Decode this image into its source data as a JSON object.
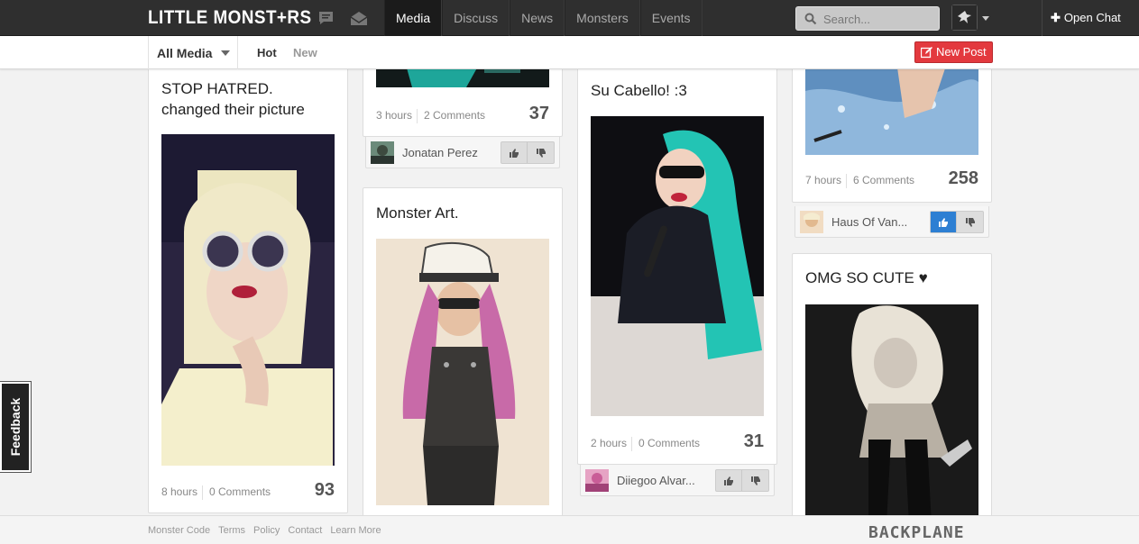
{
  "app": {
    "logo": "LITTLE MONST+RS"
  },
  "topbar": {
    "icons": [
      "chat-bubble-icon",
      "mail-icon"
    ],
    "nav": [
      {
        "label": "Media",
        "active": true
      },
      {
        "label": "Discuss",
        "active": false
      },
      {
        "label": "News",
        "active": false
      },
      {
        "label": "Monsters",
        "active": false
      },
      {
        "label": "Events",
        "active": false
      }
    ],
    "search": {
      "placeholder": "Search...",
      "value": ""
    },
    "open_chat": "Open Chat"
  },
  "subbar": {
    "filter": "All Media",
    "tabs": [
      {
        "label": "Hot",
        "active": true
      },
      {
        "label": "New",
        "active": false
      }
    ],
    "new_post": "New Post"
  },
  "colors": {
    "accent_red": "#e3393e",
    "vote_active": "#2d7fd3",
    "topbar": "#2f2f2f"
  },
  "posts": [
    {
      "title": "STOP HATRED. changed their picture",
      "time": "8 hours",
      "comments": "0 Comments",
      "score": "93"
    },
    {
      "title": "",
      "time": "3 hours",
      "comments": "2 Comments",
      "score": "37",
      "author": "Jonatan Perez",
      "upvoted": false
    },
    {
      "title": "Monster Art.",
      "time": "",
      "comments": "",
      "score": ""
    },
    {
      "title": "Su Cabello! :3",
      "time": "2 hours",
      "comments": "0 Comments",
      "score": "31",
      "author": "Diiegoo Alvar...",
      "upvoted": false
    },
    {
      "title": "",
      "time": "7 hours",
      "comments": "6 Comments",
      "score": "258",
      "author": "Haus Of Van...",
      "upvoted": true
    },
    {
      "title": "OMG SO CUTE ♥",
      "time": "",
      "comments": "",
      "score": ""
    }
  ],
  "feedback": "Feedback",
  "footer": {
    "links": [
      "Monster Code",
      "Terms",
      "Policy",
      "Contact",
      "Learn More"
    ],
    "brand": "BACKPLANE"
  }
}
